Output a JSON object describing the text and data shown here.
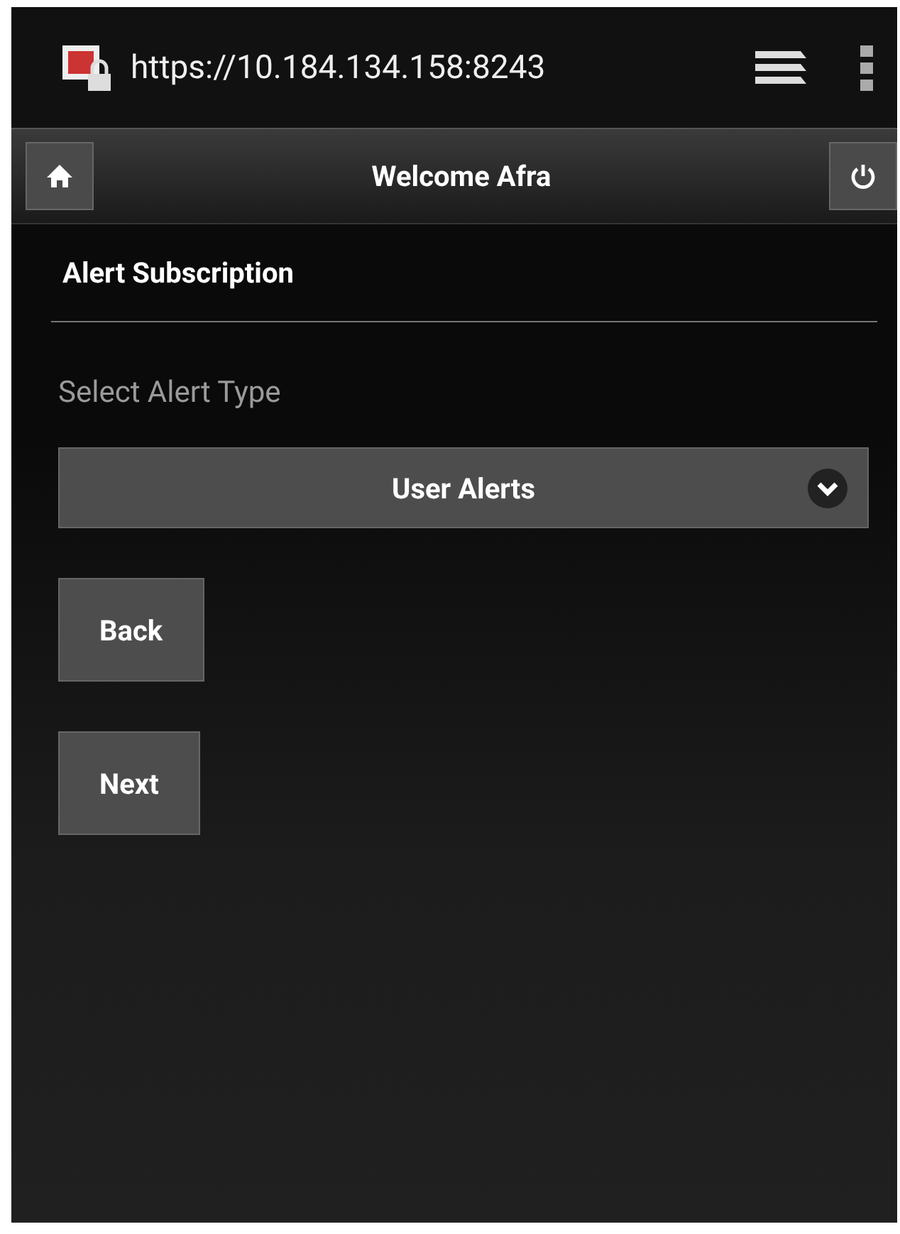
{
  "browser_bar": {
    "url": "https://10.184.134.158:8243"
  },
  "header": {
    "title": "Welcome Afra"
  },
  "section": {
    "title": "Alert Subscription"
  },
  "alert_type": {
    "label": "Select Alert Type",
    "value": "User Alerts"
  },
  "buttons": [
    "Back",
    "Next"
  ]
}
